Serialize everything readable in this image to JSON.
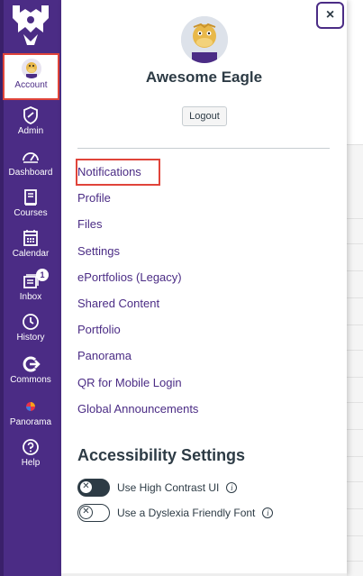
{
  "nav": {
    "items": [
      {
        "label": "Account",
        "icon": "avatar"
      },
      {
        "label": "Admin",
        "icon": "shield-icon"
      },
      {
        "label": "Dashboard",
        "icon": "dashboard-icon"
      },
      {
        "label": "Courses",
        "icon": "book-icon"
      },
      {
        "label": "Calendar",
        "icon": "calendar-icon"
      },
      {
        "label": "Inbox",
        "icon": "inbox-icon",
        "badge": "1"
      },
      {
        "label": "History",
        "icon": "clock-icon"
      },
      {
        "label": "Commons",
        "icon": "commons-icon"
      },
      {
        "label": "Panorama",
        "icon": "panorama-icon"
      },
      {
        "label": "Help",
        "icon": "help-icon"
      }
    ]
  },
  "tray": {
    "close_label": "×",
    "user_name": "Awesome Eagle",
    "logout_label": "Logout",
    "links": [
      "Notifications",
      "Profile",
      "Files",
      "Settings",
      "ePortfolios (Legacy)",
      "Shared Content",
      "Portfolio",
      "Panorama",
      "QR for Mobile Login",
      "Global Announcements"
    ],
    "accessibility": {
      "title": "Accessibility Settings",
      "high_contrast_label": "Use High Contrast UI",
      "dyslexia_label": "Use a Dyslexia Friendly Font",
      "high_contrast_on": false,
      "dyslexia_on": false
    }
  },
  "colors": {
    "brand": "#4b2c85",
    "highlight": "#e0443a",
    "text": "#2d3b45"
  }
}
